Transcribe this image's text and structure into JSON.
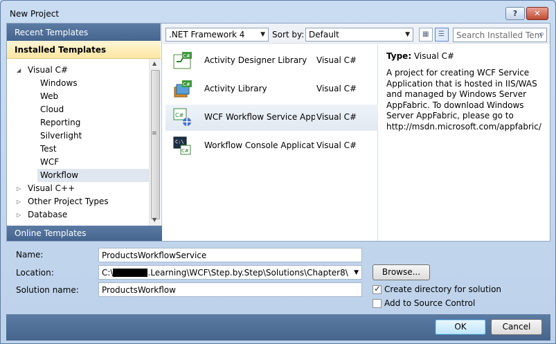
{
  "window": {
    "title": "New Project",
    "help_label": "?",
    "close_label": "✕"
  },
  "left_pane": {
    "recent_header": "Recent Templates",
    "installed_header": "Installed Templates",
    "online_header": "Online Templates",
    "tree": [
      {
        "label": "Visual C#",
        "expanded": true,
        "level": 0
      },
      {
        "label": "Windows",
        "level": 1
      },
      {
        "label": "Web",
        "level": 1
      },
      {
        "label": "Cloud",
        "level": 1
      },
      {
        "label": "Reporting",
        "level": 1
      },
      {
        "label": "Silverlight",
        "level": 1
      },
      {
        "label": "Test",
        "level": 1
      },
      {
        "label": "WCF",
        "level": 1
      },
      {
        "label": "Workflow",
        "level": 1,
        "selected": true
      },
      {
        "label": "Visual C++",
        "expanded": false,
        "level": 0
      },
      {
        "label": "Other Project Types",
        "expanded": false,
        "level": 0
      },
      {
        "label": "Database",
        "expanded": false,
        "level": 0
      }
    ]
  },
  "toolbar": {
    "framework": ".NET Framework 4",
    "sort_label": "Sort by:",
    "sort_value": "Default",
    "search_placeholder": "Search Installed Tem"
  },
  "templates": [
    {
      "name": "Activity Designer Library",
      "lang": "Visual C#",
      "icon": "activity-designer-icon"
    },
    {
      "name": "Activity Library",
      "lang": "Visual C#",
      "icon": "activity-library-icon"
    },
    {
      "name": "WCF Workflow Service Appli...",
      "lang": "Visual C#",
      "icon": "wcf-workflow-icon",
      "selected": true
    },
    {
      "name": "Workflow Console Application",
      "lang": "Visual C#",
      "icon": "workflow-console-icon"
    }
  ],
  "description": {
    "type_label": "Type:",
    "type_value": "Visual C#",
    "text": "A project for creating WCF Service Application that is hosted in IIS/WAS and managed by Windows Server AppFabric. To download Windows Server AppFabric, please go to http://msdn.microsoft.com/appfabric/"
  },
  "form": {
    "name_label": "Name:",
    "name_value": "ProductsWorkflowService",
    "location_label": "Location:",
    "location_prefix": "C:\\",
    "location_suffix": ".Learning\\WCF\\Step.by.Step\\Solutions\\Chapter8\\",
    "browse_label": "Browse...",
    "solution_label": "Solution name:",
    "solution_value": "ProductsWorkflow",
    "create_dir_label": "Create directory for solution",
    "create_dir_checked": true,
    "source_control_label": "Add to Source Control",
    "source_control_checked": false
  },
  "buttons": {
    "ok": "OK",
    "cancel": "Cancel"
  }
}
